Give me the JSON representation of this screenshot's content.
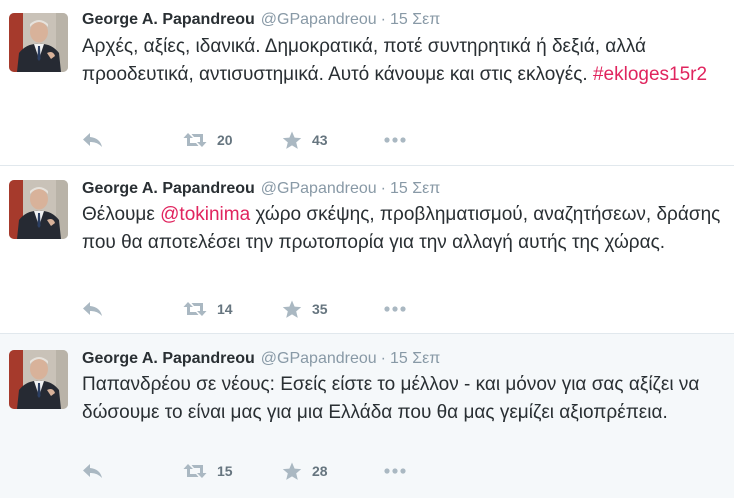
{
  "tweets": [
    {
      "name": "George A. Papandreou",
      "handle": "@GPapandreou",
      "separator": "·",
      "time": "15 Σεπ",
      "text_before": "Αρχές, αξίες, ιδανικά. Δημοκρατικά, ποτέ συντηρητικά ή δεξιά, αλλά προοδευτικά, αντισυστημικά. Αυτό κάνουμε και στις εκλογές. ",
      "hashtag": "#ekloges15r2",
      "retweets": "20",
      "favorites": "43"
    },
    {
      "name": "George A. Papandreou",
      "handle": "@GPapandreou",
      "separator": "·",
      "time": "15 Σεπ",
      "text_before": "Θέλουμε ",
      "mention": "@tokinima",
      "text_after": " χώρο σκέψης, προβληματισμού, αναζητήσεων, δράσης που θα αποτελέσει την πρωτοπορία για την αλλαγή αυτής της χώρας.",
      "retweets": "14",
      "favorites": "35"
    },
    {
      "name": "George A. Papandreou",
      "handle": "@GPapandreou",
      "separator": "·",
      "time": "15 Σεπ",
      "text_before": "Παπανδρέου σε νέους: Εσείς είστε το μέλλον - και μόνον για σας αξίζει να δώσουμε το είναι μας για μια Ελλάδα που θα μας γεμίζει αξιοπρέπεια.",
      "retweets": "15",
      "favorites": "28"
    }
  ],
  "icons": {
    "reply": "reply-icon",
    "retweet": "retweet-icon",
    "favorite": "star-icon",
    "more": "more-icon"
  },
  "colors": {
    "link": "#e0245e",
    "muted": "#8899a6",
    "text": "#292f33",
    "action": "#aab8c2"
  }
}
